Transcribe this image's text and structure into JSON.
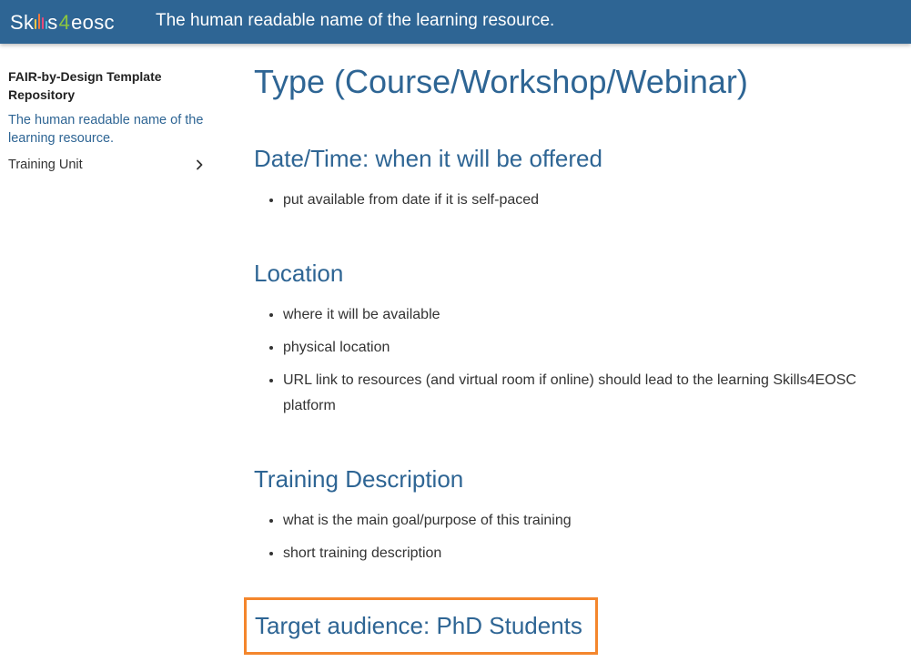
{
  "header": {
    "logo": {
      "part1": "Sk",
      "part2": "s",
      "four": "4",
      "part3": "eosc"
    },
    "title": "The human readable name of the learning resource.",
    "background": "#2e6594"
  },
  "sidebar": {
    "repo_title": "FAIR-by-Design Template Repository",
    "active_item": "The human readable name of the learning resource.",
    "unit_item": "Training Unit",
    "unit_icon": "chevron-right-icon"
  },
  "main": {
    "title": "Type (Course/Workshop/Webinar)",
    "sections": [
      {
        "heading": "Date/Time: when it will be offered",
        "items": [
          "put available from date if it is self-paced"
        ]
      },
      {
        "heading": "Location",
        "items": [
          "where it will be available",
          "physical location",
          "URL link to resources (and virtual room if online) should lead to the learning Skills4EOSC platform"
        ]
      },
      {
        "heading": "Training Description",
        "items": [
          "what is the main goal/purpose of this training",
          "short training description"
        ]
      }
    ],
    "target_heading": "Target audience: PhD Students",
    "highlight_color": "#f4862c",
    "accent_color": "#2e6594"
  }
}
